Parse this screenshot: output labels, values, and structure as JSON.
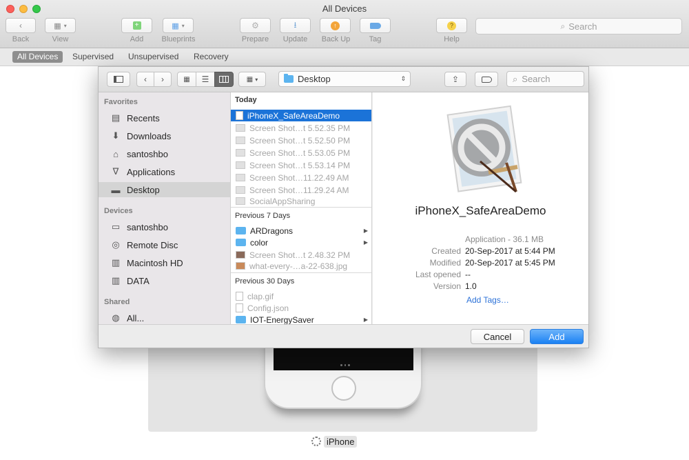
{
  "window": {
    "title": "All Devices",
    "toolbar": [
      {
        "id": "back",
        "label": "Back",
        "icon": "chevron-left-icon"
      },
      {
        "id": "view",
        "label": "View",
        "icon": "calendar-grid-icon"
      },
      {
        "id": "add",
        "label": "Add",
        "icon": "plus-icon"
      },
      {
        "id": "blueprints",
        "label": "Blueprints",
        "icon": "blueprint-grid-icon"
      },
      {
        "id": "prepare",
        "label": "Prepare",
        "icon": "gear-icon"
      },
      {
        "id": "update",
        "label": "Update",
        "icon": "download-icon"
      },
      {
        "id": "backup",
        "label": "Back Up",
        "icon": "arrow-up-circle-icon"
      },
      {
        "id": "tag",
        "label": "Tag",
        "icon": "tag-icon"
      },
      {
        "id": "help",
        "label": "Help",
        "icon": "question-icon"
      }
    ],
    "search_placeholder": "Search",
    "segments": [
      "All Devices",
      "Supervised",
      "Unsupervised",
      "Recovery"
    ],
    "active_segment": "All Devices",
    "device_name": "iPhone"
  },
  "dialog": {
    "path": "Desktop",
    "search_placeholder": "Search",
    "sidebar": {
      "favorites_heading": "Favorites",
      "favorites": [
        {
          "label": "Recents",
          "icon": "clock-icon"
        },
        {
          "label": "Downloads",
          "icon": "download-circle-icon"
        },
        {
          "label": "santoshbo",
          "icon": "home-icon"
        },
        {
          "label": "Applications",
          "icon": "applications-icon"
        },
        {
          "label": "Desktop",
          "icon": "desktop-icon"
        }
      ],
      "devices_heading": "Devices",
      "devices": [
        {
          "label": "santoshbo",
          "icon": "laptop-icon"
        },
        {
          "label": "Remote Disc",
          "icon": "disc-icon"
        },
        {
          "label": "Macintosh HD",
          "icon": "hard-drive-icon"
        },
        {
          "label": "DATA",
          "icon": "hard-drive-icon"
        }
      ],
      "shared_heading": "Shared",
      "shared": [
        {
          "label": "All...",
          "icon": "network-icon"
        }
      ]
    },
    "files": {
      "today_heading": "Today",
      "today": [
        "iPhoneX_SafeAreaDemo",
        "Screen Shot…t 5.52.35 PM",
        "Screen Shot…t 5.52.50 PM",
        "Screen Shot…t 5.53.05 PM",
        "Screen Shot…t 5.53.14 PM",
        "Screen Shot…11.22.49 AM",
        "Screen Shot…11.29.24 AM",
        "SocialAppSharing"
      ],
      "prev7_heading": "Previous 7 Days",
      "prev7": [
        "ARDragons",
        "color",
        "Screen Shot…t 2.48.32 PM",
        "what-every-…a-22-638.jpg"
      ],
      "prev30_heading": "Previous 30 Days",
      "prev30": [
        "clap.gif",
        "Config.json",
        "IOT-EnergySaver"
      ]
    },
    "preview": {
      "name": "iPhoneX_SafeAreaDemo",
      "kind": "Application - 36.1 MB",
      "created_label": "Created",
      "created": "20-Sep-2017 at 5:44 PM",
      "modified_label": "Modified",
      "modified": "20-Sep-2017 at 5:45 PM",
      "last_opened_label": "Last opened",
      "last_opened": "--",
      "version_label": "Version",
      "version": "1.0",
      "add_tags": "Add Tags…"
    },
    "cancel_label": "Cancel",
    "add_label": "Add"
  }
}
